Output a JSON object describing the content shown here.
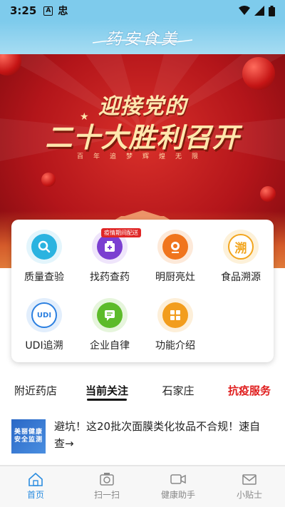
{
  "status_bar": {
    "time": "3:25",
    "notif_a": "A",
    "notif_glyph": "忠"
  },
  "header": {
    "title": "药安食美"
  },
  "banner": {
    "line1": "迎接党的",
    "line2": "二十大胜利召开",
    "subline": "百年追梦辉煌无限"
  },
  "services": {
    "items": [
      {
        "label": "质量查验",
        "icon": "search-icon",
        "color": "#2bb3e0"
      },
      {
        "label": "找药查药",
        "icon": "medicine-icon",
        "color": "#7b3fd1",
        "badge": "疫情期间配送"
      },
      {
        "label": "明厨亮灶",
        "icon": "camera-icon",
        "color": "#f0751e"
      },
      {
        "label": "食品溯源",
        "icon": "trace-icon",
        "color": "#f2a51e"
      },
      {
        "label": "UDI追溯",
        "icon": "udi-icon",
        "color": "#2b7fe0"
      },
      {
        "label": "企业自律",
        "icon": "chat-icon",
        "color": "#5dbb2a"
      },
      {
        "label": "功能介绍",
        "icon": "grid-icon",
        "color": "#f29d1e"
      }
    ],
    "trace_glyph": "溯",
    "udi_text": "UDI"
  },
  "tabs": [
    {
      "label": "附近药店"
    },
    {
      "label": "当前关注"
    },
    {
      "label": "石家庄"
    },
    {
      "label": "抗疫服务"
    }
  ],
  "article": {
    "thumb_text": "美丽健康 安全监测",
    "title": "避坑！这20批次面膜类化妆品不合规！速自查→"
  },
  "bottom_nav": [
    {
      "label": "首页",
      "icon": "home-icon"
    },
    {
      "label": "扫一扫",
      "icon": "scan-icon"
    },
    {
      "label": "健康助手",
      "icon": "video-icon"
    },
    {
      "label": "小贴士",
      "icon": "mail-icon"
    }
  ]
}
